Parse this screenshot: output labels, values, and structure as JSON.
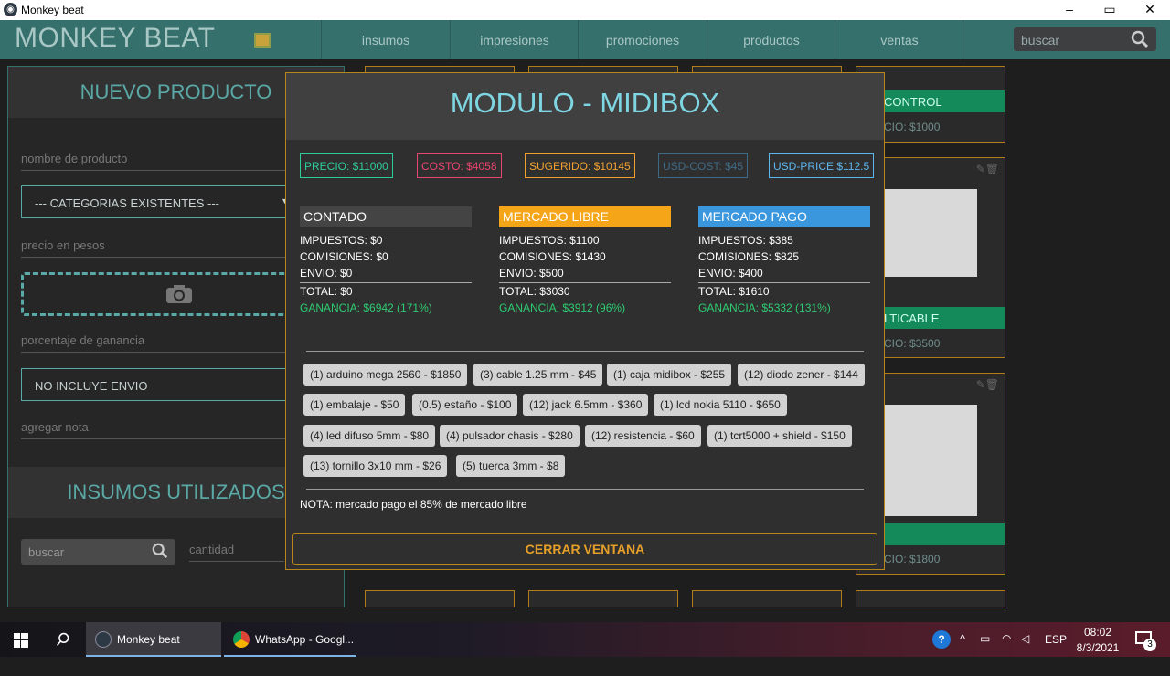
{
  "window": {
    "title": "Monkey beat",
    "minimize": "–",
    "maximize": "▭",
    "close": "✕"
  },
  "nav": {
    "brand": "MONKEY BEAT",
    "links": [
      "insumos",
      "impresiones",
      "promociones",
      "productos",
      "ventas"
    ],
    "search_placeholder": "buscar"
  },
  "left": {
    "header": "NUEVO PRODUCTO",
    "name_placeholder": "nombre de producto",
    "category": "--- CATEGORIAS EXISTENTES ---",
    "price_placeholder": "precio en pesos",
    "percent_placeholder": "porcentaje de ganancia",
    "shipping": "NO INCLUYE ENVIO",
    "note_placeholder": "agregar nota",
    "insumos_header": "INSUMOS UTILIZADOS",
    "search_placeholder": "buscar",
    "qty_placeholder": "cantidad"
  },
  "cards": [
    {
      "name": "CONTROL",
      "price": "CIO: $1000"
    },
    {
      "name": "LTICABLE",
      "price": "CIO: $3500"
    },
    {
      "name": "",
      "price": "CIO: $1800"
    }
  ],
  "modal": {
    "title": "MODULO - MIDIBOX",
    "tags": [
      {
        "text": "PRECIO: $11000",
        "color": "#2ecc9a"
      },
      {
        "text": "COSTO: $4058",
        "color": "#e8456f"
      },
      {
        "text": "SUGERIDO: $10145",
        "color": "#f0a030"
      },
      {
        "text": "USD-COST: $45",
        "color": "#3f6a86"
      },
      {
        "text": "USD-PRICE $112.5",
        "color": "#5db6ee"
      }
    ],
    "columns": [
      {
        "title": "CONTADO",
        "bg": "#444444",
        "impuestos": "IMPUESTOS: $0",
        "comisiones": "COMISIONES: $0",
        "envio": "ENVIO: $0",
        "total": "TOTAL: $0",
        "ganancia": "GANANCIA: $6942 (171%)"
      },
      {
        "title": "MERCADO LIBRE",
        "bg": "#f5a518",
        "impuestos": "IMPUESTOS: $1100",
        "comisiones": "COMISIONES: $1430",
        "envio": "ENVIO: $500",
        "total": "TOTAL: $3030",
        "ganancia": "GANANCIA: $3912 (96%)"
      },
      {
        "title": "MERCADO PAGO",
        "bg": "#3a97dd",
        "impuestos": "IMPUESTOS: $385",
        "comisiones": "COMISIONES: $825",
        "envio": "ENVIO: $400",
        "total": "TOTAL: $1610",
        "ganancia": "GANANCIA: $5332 (131%)"
      }
    ],
    "items": [
      "(1) arduino mega 2560 - $1850",
      "(3) cable 1.25 mm - $45",
      "(1) caja midibox - $255",
      "(12) diodo zener - $144",
      "(1) embalaje - $50",
      "(0.5) estaño - $100",
      "(12) jack 6.5mm - $360",
      "(1) lcd nokia 5110 - $650",
      "(4) led difuso 5mm - $80",
      "(4) pulsador chasis - $280",
      "(12) resistencia - $60",
      "(1) tcrt5000 + shield - $150",
      "(13) tornillo 3x10 mm - $26",
      "(5) tuerca 3mm - $8"
    ],
    "note": "NOTA: mercado pago el 85% de mercado libre",
    "close": "CERRAR VENTANA"
  },
  "taskbar": {
    "app1": "Monkey beat",
    "app2": "WhatsApp - Googl...",
    "lang": "ESP",
    "time": "08:02",
    "date": "8/3/2021",
    "notif": "3"
  }
}
